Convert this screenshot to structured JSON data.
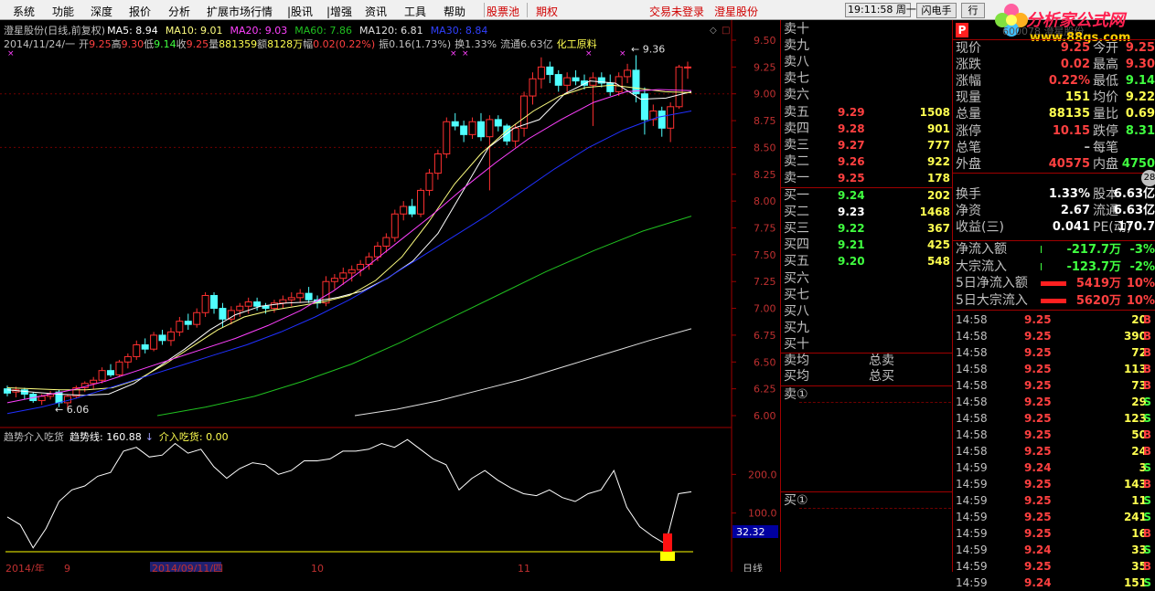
{
  "menu": {
    "items": [
      "系统",
      "功能",
      "深度",
      "报价",
      "分析",
      "扩展市场行情",
      "|股讯",
      "|增强",
      "资讯",
      "工具",
      "帮助"
    ],
    "red_items": [
      "股票池",
      "期权"
    ],
    "trade": "交易未登录",
    "stock_name": "澄星股份",
    "clock": "19:11:58 周一",
    "btn_lightning": "闪电手",
    "btn_trade": "行"
  },
  "watermark": {
    "title": "分析家公式网",
    "url": "www.88gs.com",
    "code": "600078 澄星股份"
  },
  "main_legend": {
    "title": "澄星股份(日线,前复权)",
    "ma5": "MA5: 8.94",
    "ma10": "MA10: 9.01",
    "ma20": "MA20: 9.03",
    "ma60": "MA60: 7.86",
    "ma120": "MA120: 6.81",
    "ma30": "MA30: 8.84"
  },
  "info_bar": {
    "date": "2014/11/24/一",
    "open_label": "开",
    "open": "9.25",
    "high_label": "高",
    "high": "9.30",
    "low_label": "低",
    "low": "9.14",
    "close_label": "收",
    "close": "9.25",
    "vol_label": "量",
    "vol": "881359",
    "amt_label": "额",
    "amt": "8128万",
    "chg_label": "幅",
    "chg": "0.02(0.22%)",
    "amp": "振0.16(1.73%)",
    "turn": "换1.33%",
    "float": "流通6.63亿",
    "industry": "化工原料"
  },
  "annotations": {
    "high_mark": "9.36",
    "low_mark": "6.06"
  },
  "price_axis": [
    "9.50",
    "9.25",
    "9.00",
    "8.75",
    "8.50",
    "8.25",
    "8.00",
    "7.75",
    "7.50",
    "7.25",
    "7.00",
    "6.75",
    "6.50",
    "6.25",
    "6.00"
  ],
  "indicator": {
    "name": "趋势介入吃货",
    "trend_label": "趋势线: 160.88",
    "eat_label": "介入吃货: 0.00",
    "axis": [
      "200.0",
      "100.0"
    ],
    "current": "32.32"
  },
  "date_axis": {
    "labels": [
      "2014/年",
      "9",
      "2014/09/11/四",
      "10",
      "11"
    ],
    "period": "日线"
  },
  "chart_data": {
    "type": "candlestick",
    "title": "澄星股份(日线,前复权)",
    "ylim": [
      6.0,
      9.5
    ],
    "ohlc": [
      [
        6.25,
        6.28,
        6.18,
        6.21
      ],
      [
        6.22,
        6.27,
        6.17,
        6.24
      ],
      [
        6.24,
        6.26,
        6.15,
        6.2
      ],
      [
        6.2,
        6.22,
        6.12,
        6.14
      ],
      [
        6.14,
        6.2,
        6.1,
        6.18
      ],
      [
        6.18,
        6.23,
        6.15,
        6.2
      ],
      [
        6.22,
        6.24,
        6.08,
        6.12
      ],
      [
        6.12,
        6.2,
        6.06,
        6.18
      ],
      [
        6.18,
        6.28,
        6.16,
        6.26
      ],
      [
        6.26,
        6.32,
        6.22,
        6.3
      ],
      [
        6.3,
        6.36,
        6.25,
        6.33
      ],
      [
        6.33,
        6.45,
        6.3,
        6.42
      ],
      [
        6.42,
        6.48,
        6.36,
        6.38
      ],
      [
        6.38,
        6.52,
        6.36,
        6.5
      ],
      [
        6.5,
        6.58,
        6.44,
        6.55
      ],
      [
        6.55,
        6.7,
        6.52,
        6.66
      ],
      [
        6.66,
        6.72,
        6.58,
        6.62
      ],
      [
        6.62,
        6.78,
        6.6,
        6.75
      ],
      [
        6.75,
        6.8,
        6.66,
        6.7
      ],
      [
        6.7,
        6.82,
        6.65,
        6.78
      ],
      [
        6.78,
        6.92,
        6.74,
        6.88
      ],
      [
        6.88,
        6.95,
        6.8,
        6.85
      ],
      [
        6.85,
        7.0,
        6.82,
        6.96
      ],
      [
        6.96,
        7.15,
        6.92,
        7.12
      ],
      [
        7.12,
        7.15,
        6.95,
        7.0
      ],
      [
        7.0,
        7.05,
        6.82,
        6.9
      ],
      [
        6.9,
        7.02,
        6.85,
        6.98
      ],
      [
        6.98,
        7.05,
        6.92,
        7.02
      ],
      [
        7.02,
        7.1,
        6.95,
        7.06
      ],
      [
        7.06,
        7.1,
        6.98,
        7.02
      ],
      [
        7.02,
        7.05,
        6.95,
        7.0
      ],
      [
        7.0,
        7.08,
        6.96,
        7.05
      ],
      [
        7.05,
        7.12,
        7.0,
        7.08
      ],
      [
        7.08,
        7.15,
        7.02,
        7.1
      ],
      [
        7.1,
        7.18,
        7.05,
        7.14
      ],
      [
        7.14,
        7.2,
        7.05,
        7.08
      ],
      [
        7.08,
        7.12,
        7.0,
        7.05
      ],
      [
        7.05,
        7.3,
        7.02,
        7.25
      ],
      [
        7.25,
        7.32,
        7.18,
        7.28
      ],
      [
        7.28,
        7.38,
        7.22,
        7.33
      ],
      [
        7.33,
        7.4,
        7.25,
        7.36
      ],
      [
        7.36,
        7.45,
        7.3,
        7.41
      ],
      [
        7.41,
        7.52,
        7.36,
        7.48
      ],
      [
        7.48,
        7.62,
        7.44,
        7.58
      ],
      [
        7.58,
        7.7,
        7.52,
        7.66
      ],
      [
        7.66,
        7.92,
        7.62,
        7.88
      ],
      [
        7.88,
        8.0,
        7.82,
        7.95
      ],
      [
        7.95,
        8.02,
        7.85,
        7.88
      ],
      [
        7.88,
        8.12,
        7.85,
        8.1
      ],
      [
        8.1,
        8.3,
        8.05,
        8.26
      ],
      [
        8.26,
        8.48,
        8.2,
        8.44
      ],
      [
        8.44,
        8.78,
        8.4,
        8.74
      ],
      [
        8.74,
        8.82,
        8.66,
        8.7
      ],
      [
        8.7,
        8.75,
        8.55,
        8.62
      ],
      [
        8.62,
        8.78,
        8.58,
        8.74
      ],
      [
        8.74,
        8.82,
        8.56,
        8.6
      ],
      [
        8.6,
        8.8,
        8.1,
        8.76
      ],
      [
        8.76,
        8.8,
        8.65,
        8.7
      ],
      [
        8.7,
        8.72,
        8.52,
        8.56
      ],
      [
        8.56,
        8.72,
        8.5,
        8.68
      ],
      [
        8.68,
        9.02,
        8.6,
        8.98
      ],
      [
        8.98,
        9.2,
        8.9,
        9.14
      ],
      [
        9.14,
        9.34,
        9.05,
        9.25
      ],
      [
        9.25,
        9.3,
        9.1,
        9.18
      ],
      [
        9.18,
        9.22,
        9.02,
        9.08
      ],
      [
        9.08,
        9.2,
        9.0,
        9.15
      ],
      [
        9.15,
        9.22,
        9.08,
        9.12
      ],
      [
        9.12,
        9.18,
        9.04,
        9.08
      ],
      [
        9.08,
        9.2,
        8.7,
        9.15
      ],
      [
        9.15,
        9.2,
        9.06,
        9.1
      ],
      [
        9.1,
        9.18,
        8.98,
        9.02
      ],
      [
        9.02,
        9.2,
        8.98,
        9.16
      ],
      [
        9.16,
        9.28,
        9.1,
        9.22
      ],
      [
        9.22,
        9.36,
        8.92,
        9.0
      ],
      [
        9.0,
        9.06,
        8.62,
        8.76
      ],
      [
        8.76,
        8.9,
        8.7,
        8.84
      ],
      [
        8.84,
        8.88,
        8.6,
        8.68
      ],
      [
        8.68,
        8.92,
        8.55,
        8.88
      ],
      [
        8.88,
        9.27,
        8.86,
        9.25
      ],
      [
        9.25,
        9.3,
        9.14,
        9.25
      ]
    ],
    "ma_series": [
      {
        "name": "MA5",
        "color": "#ffffff",
        "last": 8.94,
        "values": [
          6.24,
          6.22,
          6.2,
          6.19,
          6.2,
          6.3,
          6.46,
          6.62,
          6.8,
          6.94,
          7.02,
          7.05,
          7.06,
          7.1,
          7.16,
          7.28,
          7.44,
          7.7,
          8.1,
          8.5,
          8.68,
          8.76,
          9.0,
          9.12,
          9.1,
          8.95,
          8.96,
          9.02
        ]
      },
      {
        "name": "MA10",
        "color": "#ffff80",
        "last": 9.01,
        "values": [
          6.26,
          6.25,
          6.24,
          6.24,
          6.26,
          6.34,
          6.48,
          6.64,
          6.8,
          6.92,
          6.98,
          7.02,
          7.06,
          7.12,
          7.26,
          7.48,
          7.8,
          8.16,
          8.44,
          8.66,
          8.84,
          8.98,
          9.06,
          9.08,
          9.05,
          9.02,
          9.01
        ]
      },
      {
        "name": "MA20",
        "color": "#ff40ff",
        "last": 9.03,
        "values": [
          6.12,
          6.18,
          6.24,
          6.32,
          6.42,
          6.52,
          6.62,
          6.72,
          6.84,
          6.98,
          7.16,
          7.38,
          7.62,
          7.86,
          8.12,
          8.36,
          8.58,
          8.76,
          8.92,
          9.02,
          9.04,
          9.03
        ]
      },
      {
        "name": "MA30",
        "color": "#2030ff",
        "last": 8.84,
        "values": [
          6.02,
          6.08,
          6.16,
          6.26,
          6.36,
          6.46,
          6.56,
          6.66,
          6.78,
          6.92,
          7.08,
          7.26,
          7.46,
          7.66,
          7.86,
          8.08,
          8.3,
          8.5,
          8.66,
          8.78,
          8.84
        ]
      },
      {
        "name": "MA60",
        "color": "#20c020",
        "last": 7.86,
        "values": [
          6.0,
          6.08,
          6.18,
          6.32,
          6.48,
          6.68,
          6.9,
          7.12,
          7.34,
          7.54,
          7.72,
          7.86
        ]
      },
      {
        "name": "MA120",
        "color": "#e0e0e0",
        "last": 6.81,
        "values": [
          6.0,
          6.06,
          6.14,
          6.24,
          6.34,
          6.46,
          6.58,
          6.7,
          6.81
        ]
      }
    ],
    "indicator_series": [
      90,
      70,
      10,
      60,
      130,
      160,
      170,
      195,
      205,
      260,
      270,
      245,
      250,
      280,
      255,
      265,
      220,
      190,
      215,
      230,
      225,
      200,
      210,
      235,
      235,
      240,
      260,
      260,
      265,
      280,
      270,
      290,
      265,
      240,
      225,
      160,
      190,
      210,
      185,
      165,
      150,
      145,
      160,
      140,
      130,
      150,
      160,
      210,
      115,
      65,
      40,
      20,
      150,
      155
    ]
  },
  "orderbook": {
    "sells": [
      {
        "label": "卖十",
        "price": "",
        "vol": ""
      },
      {
        "label": "卖九",
        "price": "",
        "vol": ""
      },
      {
        "label": "卖八",
        "price": "",
        "vol": ""
      },
      {
        "label": "卖七",
        "price": "",
        "vol": ""
      },
      {
        "label": "卖六",
        "price": "",
        "vol": ""
      },
      {
        "label": "卖五",
        "price": "9.29",
        "vol": "1508"
      },
      {
        "label": "卖四",
        "price": "9.28",
        "vol": "901"
      },
      {
        "label": "卖三",
        "price": "9.27",
        "vol": "777"
      },
      {
        "label": "卖二",
        "price": "9.26",
        "vol": "922"
      },
      {
        "label": "卖一",
        "price": "9.25",
        "vol": "178"
      }
    ],
    "buys": [
      {
        "label": "买一",
        "price": "9.24",
        "vol": "202"
      },
      {
        "label": "买二",
        "price": "9.23",
        "vol": "1468"
      },
      {
        "label": "买三",
        "price": "9.22",
        "vol": "367"
      },
      {
        "label": "买四",
        "price": "9.21",
        "vol": "425"
      },
      {
        "label": "买五",
        "price": "9.20",
        "vol": "548"
      },
      {
        "label": "买六",
        "price": "",
        "vol": ""
      },
      {
        "label": "买七",
        "price": "",
        "vol": ""
      },
      {
        "label": "买八",
        "price": "",
        "vol": ""
      },
      {
        "label": "买九",
        "price": "",
        "vol": ""
      },
      {
        "label": "买十",
        "price": "",
        "vol": ""
      }
    ],
    "sell_avg": "卖均",
    "buy_avg": "买均",
    "total_sell": "总卖",
    "total_buy": "总买",
    "sell_queue": "卖①",
    "buy_queue": "买①"
  },
  "quote": {
    "header_icon": "P",
    "rows": [
      {
        "a": "现价",
        "b": "9.25",
        "bc": "#ff4040",
        "c": "今开",
        "d": "9.25",
        "dc": "#ff4040"
      },
      {
        "a": "涨跌",
        "b": "0.02",
        "bc": "#ff4040",
        "c": "最高",
        "d": "9.30",
        "dc": "#ff4040"
      },
      {
        "a": "涨幅",
        "b": "0.22%",
        "bc": "#ff4040",
        "c": "最低",
        "d": "9.14",
        "dc": "#40ff40"
      },
      {
        "a": "现量",
        "b": "151",
        "bc": "#ffff50",
        "c": "均价",
        "d": "9.22",
        "dc": "#ffff50"
      },
      {
        "a": "总量",
        "b": "88135",
        "bc": "#ffff50",
        "c": "量比",
        "d": "0.69",
        "dc": "#ffff50"
      },
      {
        "a": "涨停",
        "b": "10.15",
        "bc": "#ff4040",
        "c": "跌停",
        "d": "8.31",
        "dc": "#40ff40"
      },
      {
        "a": "总笔",
        "b": "–",
        "bc": "#c0c0c0",
        "c": "每笔",
        "d": "",
        "dc": "#c0c0c0"
      },
      {
        "a": "外盘",
        "b": "40575",
        "bc": "#ff4040",
        "c": "内盘",
        "d": "4750",
        "dc": "#40ff40"
      },
      {
        "a": "换手",
        "b": "1.33%",
        "bc": "#ffffff",
        "c": "股本",
        "d": "6.63亿",
        "dc": "#ffffff"
      },
      {
        "a": "净资",
        "b": "2.67",
        "bc": "#ffffff",
        "c": "流通",
        "d": "6.63亿",
        "dc": "#ffffff"
      },
      {
        "a": "收益(三)",
        "b": "0.041",
        "bc": "#ffffff",
        "c": "PE(动)",
        "d": "170.7",
        "dc": "#ffffff"
      }
    ],
    "badge": "28",
    "flows": [
      {
        "a": "净流入额",
        "b": "-217.7万",
        "bc": "#40ff40",
        "d": "-3%",
        "dc": "#40ff40",
        "bar": 0.02,
        "barc": "#40ff40"
      },
      {
        "a": "大宗流入",
        "b": "-123.7万",
        "bc": "#40ff40",
        "d": "-2%",
        "dc": "#40ff40",
        "bar": 0.02,
        "barc": "#40ff40"
      },
      {
        "a": "5日净流入额",
        "b": "5419万",
        "bc": "#ff4040",
        "d": "10%",
        "dc": "#ff4040",
        "bar": 1,
        "barc": "#ff2020"
      },
      {
        "a": "5日大宗流入",
        "b": "5620万",
        "bc": "#ff4040",
        "d": "10%",
        "dc": "#ff4040",
        "bar": 1,
        "barc": "#ff2020"
      }
    ],
    "ticks": [
      {
        "t": "14:58",
        "p": "9.25",
        "pc": "#ff4040",
        "v": "20",
        "s": "B",
        "sc": "#ff4040"
      },
      {
        "t": "14:58",
        "p": "9.25",
        "pc": "#ff4040",
        "v": "390",
        "s": "B",
        "sc": "#ff4040"
      },
      {
        "t": "14:58",
        "p": "9.25",
        "pc": "#ff4040",
        "v": "72",
        "s": "B",
        "sc": "#ff4040"
      },
      {
        "t": "14:58",
        "p": "9.25",
        "pc": "#ff4040",
        "v": "113",
        "s": "B",
        "sc": "#ff4040"
      },
      {
        "t": "14:58",
        "p": "9.25",
        "pc": "#ff4040",
        "v": "73",
        "s": "B",
        "sc": "#ff4040"
      },
      {
        "t": "14:58",
        "p": "9.25",
        "pc": "#ff4040",
        "v": "29",
        "s": "S",
        "sc": "#40ff40"
      },
      {
        "t": "14:58",
        "p": "9.25",
        "pc": "#ff4040",
        "v": "123",
        "s": "S",
        "sc": "#40ff40"
      },
      {
        "t": "14:58",
        "p": "9.25",
        "pc": "#ff4040",
        "v": "50",
        "s": "B",
        "sc": "#ff4040"
      },
      {
        "t": "14:58",
        "p": "9.25",
        "pc": "#ff4040",
        "v": "24",
        "s": "B",
        "sc": "#ff4040"
      },
      {
        "t": "14:59",
        "p": "9.24",
        "pc": "#ff4040",
        "v": "3",
        "s": "S",
        "sc": "#40ff40"
      },
      {
        "t": "14:59",
        "p": "9.25",
        "pc": "#ff4040",
        "v": "143",
        "s": "B",
        "sc": "#ff4040"
      },
      {
        "t": "14:59",
        "p": "9.25",
        "pc": "#ff4040",
        "v": "11",
        "s": "S",
        "sc": "#40ff40"
      },
      {
        "t": "14:59",
        "p": "9.25",
        "pc": "#ff4040",
        "v": "241",
        "s": "S",
        "sc": "#40ff40"
      },
      {
        "t": "14:59",
        "p": "9.25",
        "pc": "#ff4040",
        "v": "16",
        "s": "B",
        "sc": "#ff4040"
      },
      {
        "t": "14:59",
        "p": "9.24",
        "pc": "#ff4040",
        "v": "33",
        "s": "S",
        "sc": "#40ff40"
      },
      {
        "t": "14:59",
        "p": "9.25",
        "pc": "#ff4040",
        "v": "35",
        "s": "B",
        "sc": "#ff4040"
      },
      {
        "t": "14:59",
        "p": "9.24",
        "pc": "#ff4040",
        "v": "151",
        "s": "S",
        "sc": "#40ff40"
      }
    ]
  }
}
